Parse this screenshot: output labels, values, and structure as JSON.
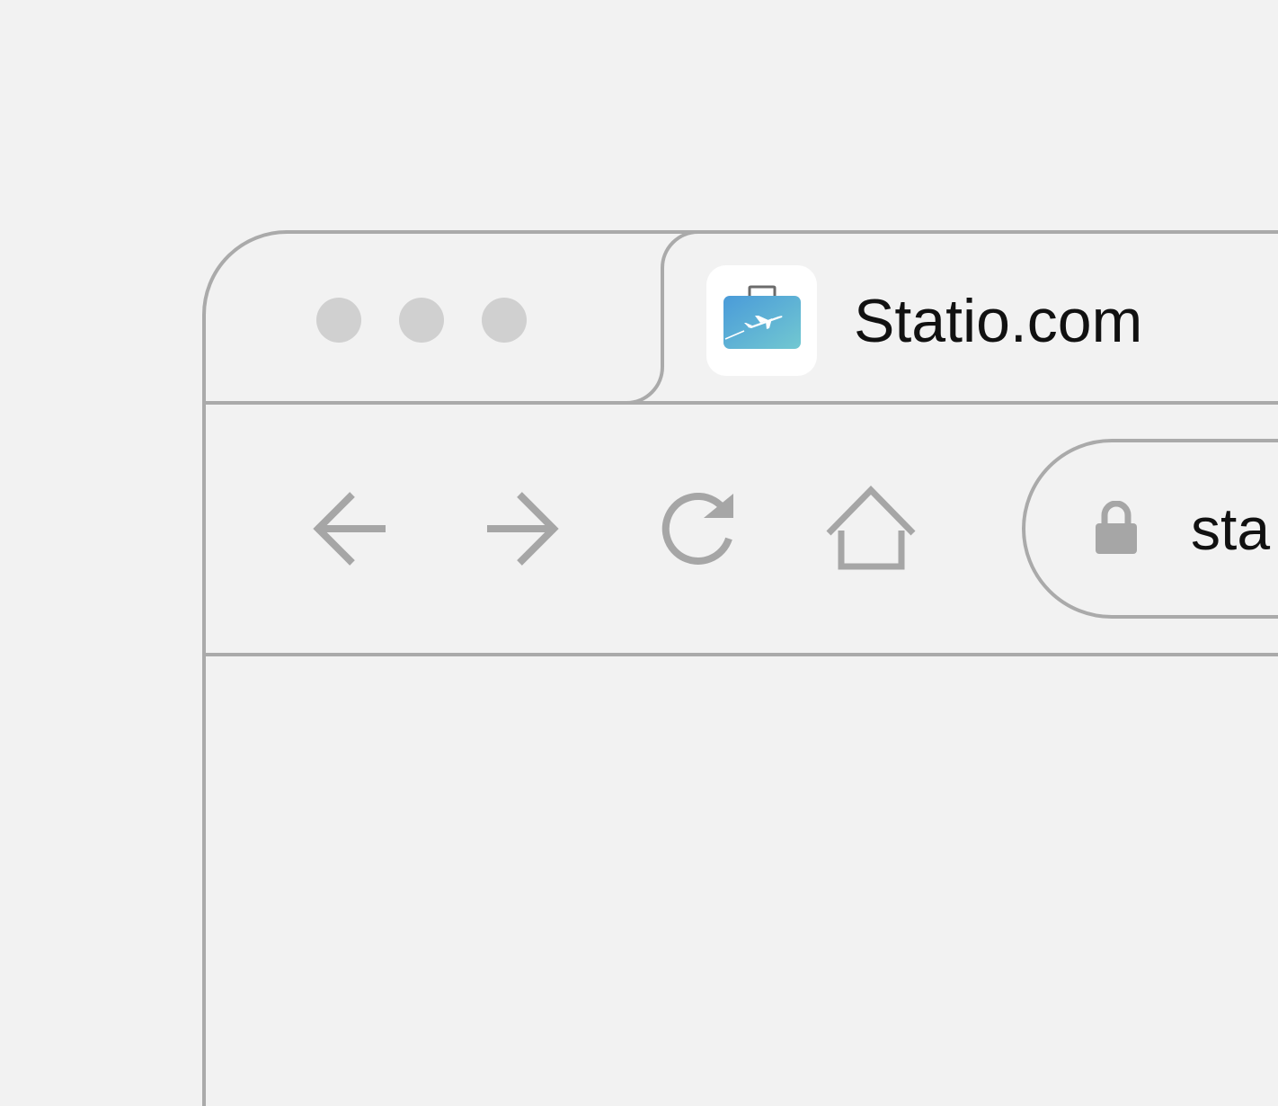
{
  "window": {
    "control_dots": [
      "window-dot",
      "window-dot",
      "window-dot"
    ]
  },
  "tab": {
    "title": "Statio.com",
    "favicon": "suitcase-airplane-icon"
  },
  "toolbar": {
    "back_icon": "arrow-left-icon",
    "forward_icon": "arrow-right-icon",
    "reload_icon": "reload-icon",
    "home_icon": "home-icon"
  },
  "address_bar": {
    "lock_icon": "lock-icon",
    "url": "sta"
  },
  "colors": {
    "page_background": "#f2f2f2",
    "frame_stroke": "#aaaaaa",
    "icon_gray": "#a6a6a6",
    "dot_gray": "#d0d0d0",
    "favicon_gradient_start": "#4a9bd9",
    "favicon_gradient_end": "#72c8d1",
    "text": "#111111"
  }
}
